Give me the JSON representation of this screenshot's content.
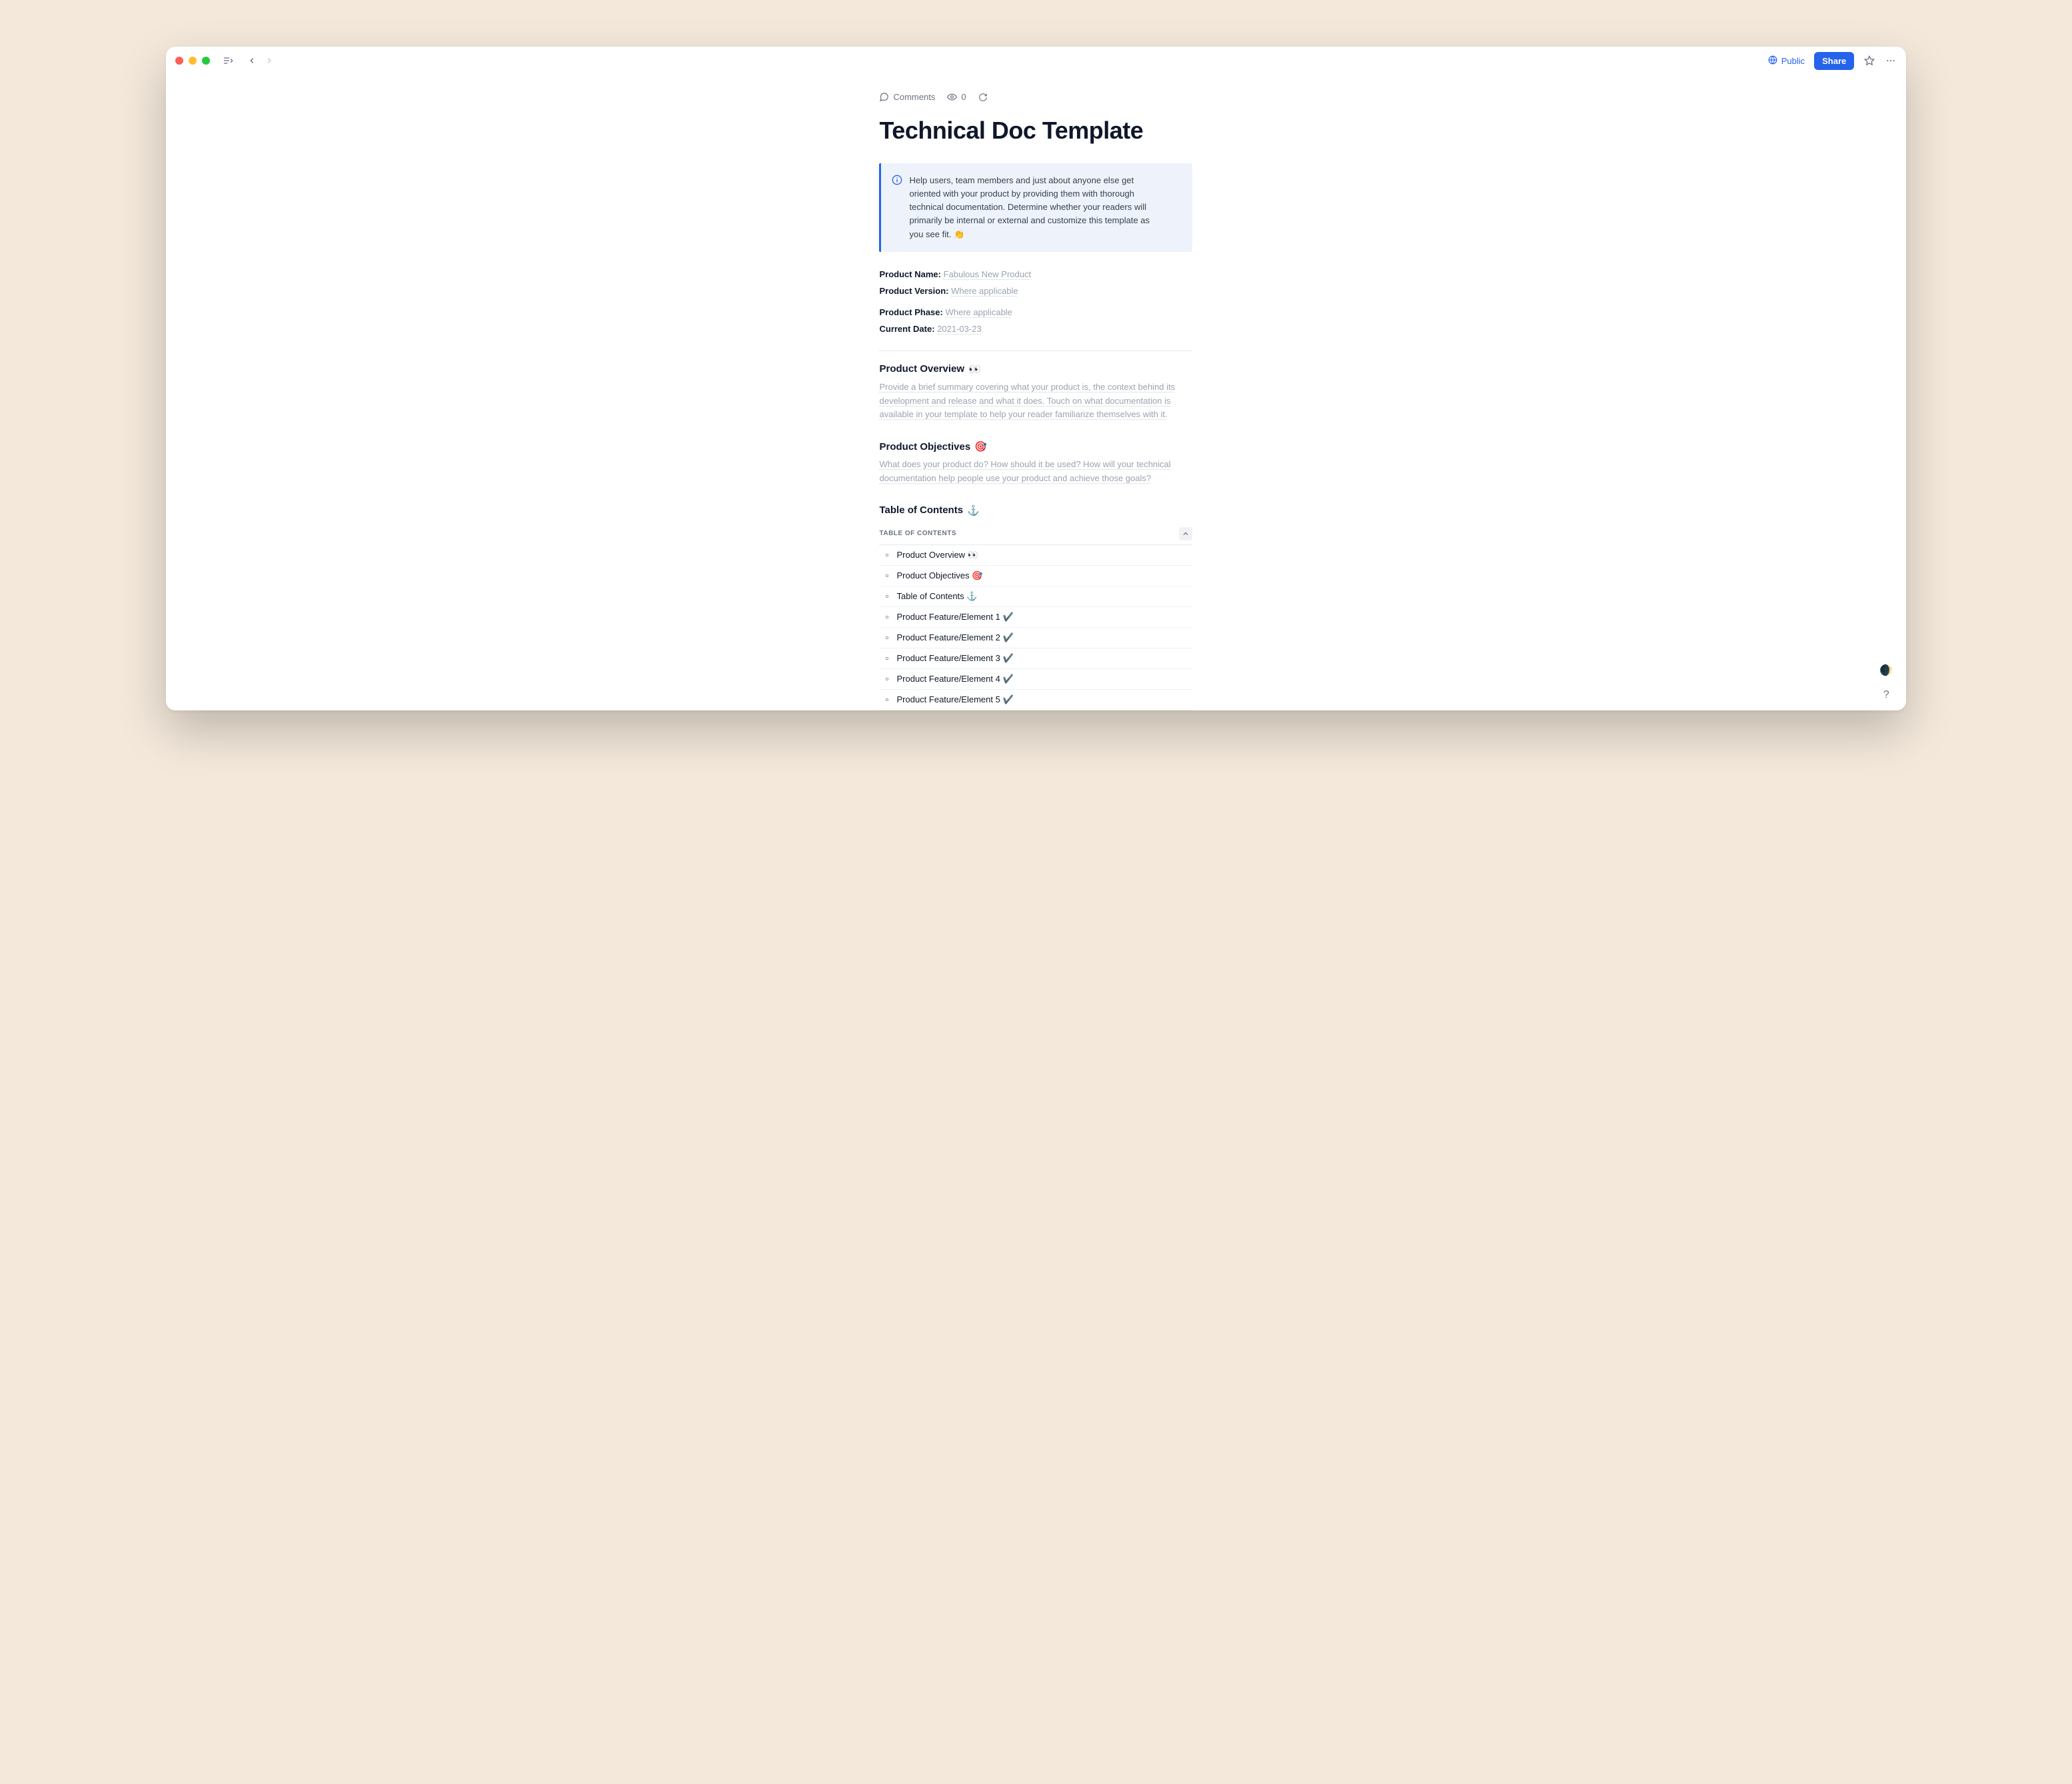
{
  "titlebar": {
    "public_label": "Public",
    "share_label": "Share"
  },
  "meta": {
    "comments_label": "Comments",
    "view_count": "0"
  },
  "doc": {
    "title": "Technical Doc Template",
    "callout": {
      "text": "Help users, team members and just about anyone else get oriented with your product by providing them with thorough technical documentation. Determine whether your readers will primarily be internal or external and customize this template as you see fit.",
      "emoji": "👏"
    },
    "fields": {
      "product_name_label": "Product Name:",
      "product_name_value": "Fabulous New Product",
      "product_version_label": "Product Version:",
      "product_version_value": "Where applicable",
      "product_phase_label": "Product Phase:",
      "product_phase_value": "Where applicable",
      "current_date_label": "Current Date:",
      "current_date_value": "2021-03-23"
    },
    "sections": {
      "overview_title": "Product Overview",
      "overview_emoji": "👀",
      "overview_body": "Provide a brief summary covering what your product is, the context behind its development and release and what it does. Touch on what documentation is available in your template to help your reader familiarize themselves with it.",
      "objectives_title": "Product Objectives",
      "objectives_emoji": "🎯",
      "objectives_body": "What does your product do? How should it be used? How will your technical documentation help people use your product and achieve those goals?",
      "toc_title": "Table of Contents",
      "toc_emoji": "⚓"
    },
    "toc": {
      "header_label": "TABLE OF CONTENTS",
      "items": [
        "Product Overview 👀",
        "Product Objectives 🎯",
        "Table of Contents ⚓",
        "Product Feature/Element 1 ✔️",
        "Product Feature/Element 2 ✔️",
        "Product Feature/Element 3 ✔️",
        "Product Feature/Element 4 ✔️",
        "Product Feature/Element 5 ✔️"
      ]
    }
  },
  "floating": {
    "globe_label": "🌒",
    "help_label": "?"
  }
}
